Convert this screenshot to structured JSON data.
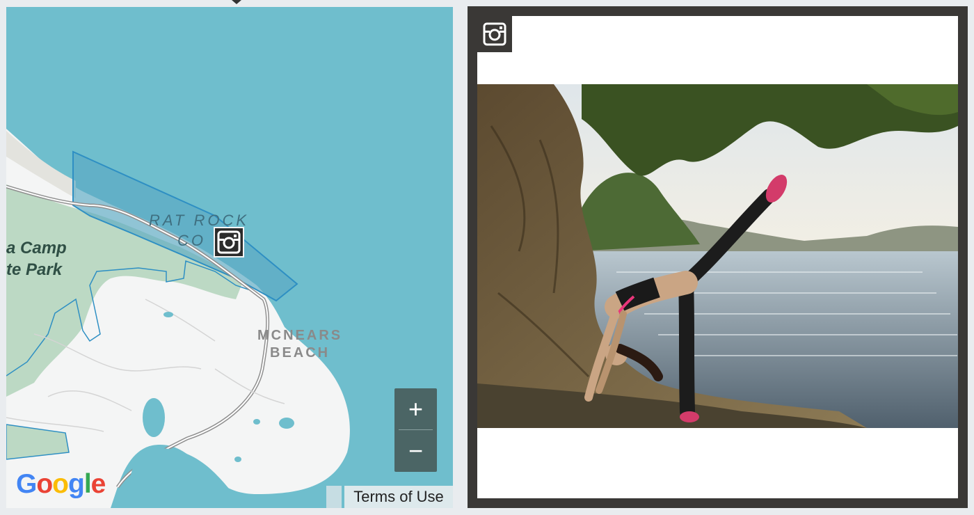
{
  "map": {
    "labels": {
      "rat_rock_line1": "RAT ROCK",
      "rat_rock_line2": "CO",
      "park_name": "a Camp\nte Park",
      "beach_line1": "MCNEARS",
      "beach_line2": "BEACH"
    },
    "controls": {
      "zoom_in": "+",
      "zoom_out": "−"
    },
    "attribution": {
      "logo_letters": [
        "G",
        "o",
        "o",
        "g",
        "l",
        "e"
      ],
      "terms": "Terms of Use"
    },
    "marker_icon": "instagram-icon",
    "colors": {
      "water": "#6fbecd",
      "land": "#f4f5f5",
      "park": "#bcd9c4",
      "boundary": "#2e8fc3",
      "road": "#8f8f8f"
    }
  },
  "photo_panel": {
    "badge_icon": "instagram-icon",
    "photo_subject": "yoga-pose-by-water-photo",
    "colors": {
      "frame": "#3a3836"
    }
  }
}
